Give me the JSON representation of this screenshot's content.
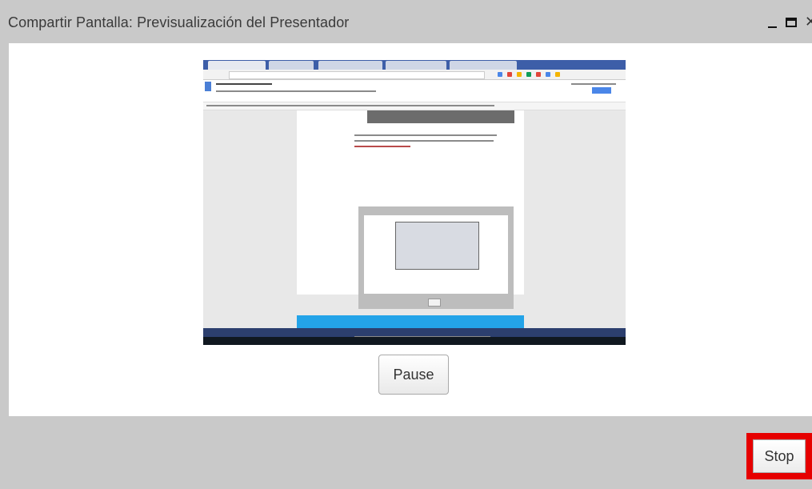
{
  "window": {
    "title": "Compartir Pantalla: Previsualización del Presentador",
    "minimize_icon": "minimize-icon",
    "maximize_icon": "maximize-icon",
    "close_icon": "close-icon"
  },
  "preview": {
    "description_icon": "screen-share-preview-image",
    "colors": {
      "browser_tabs": "#3d5ea8",
      "doc_page": "#ffffff",
      "accent_bar": "#23a3e8",
      "taskbar": "#101820"
    }
  },
  "controls": {
    "pause_label": "Pause",
    "stop_label": "Stop",
    "stop_highlight_color": "#e60000"
  }
}
